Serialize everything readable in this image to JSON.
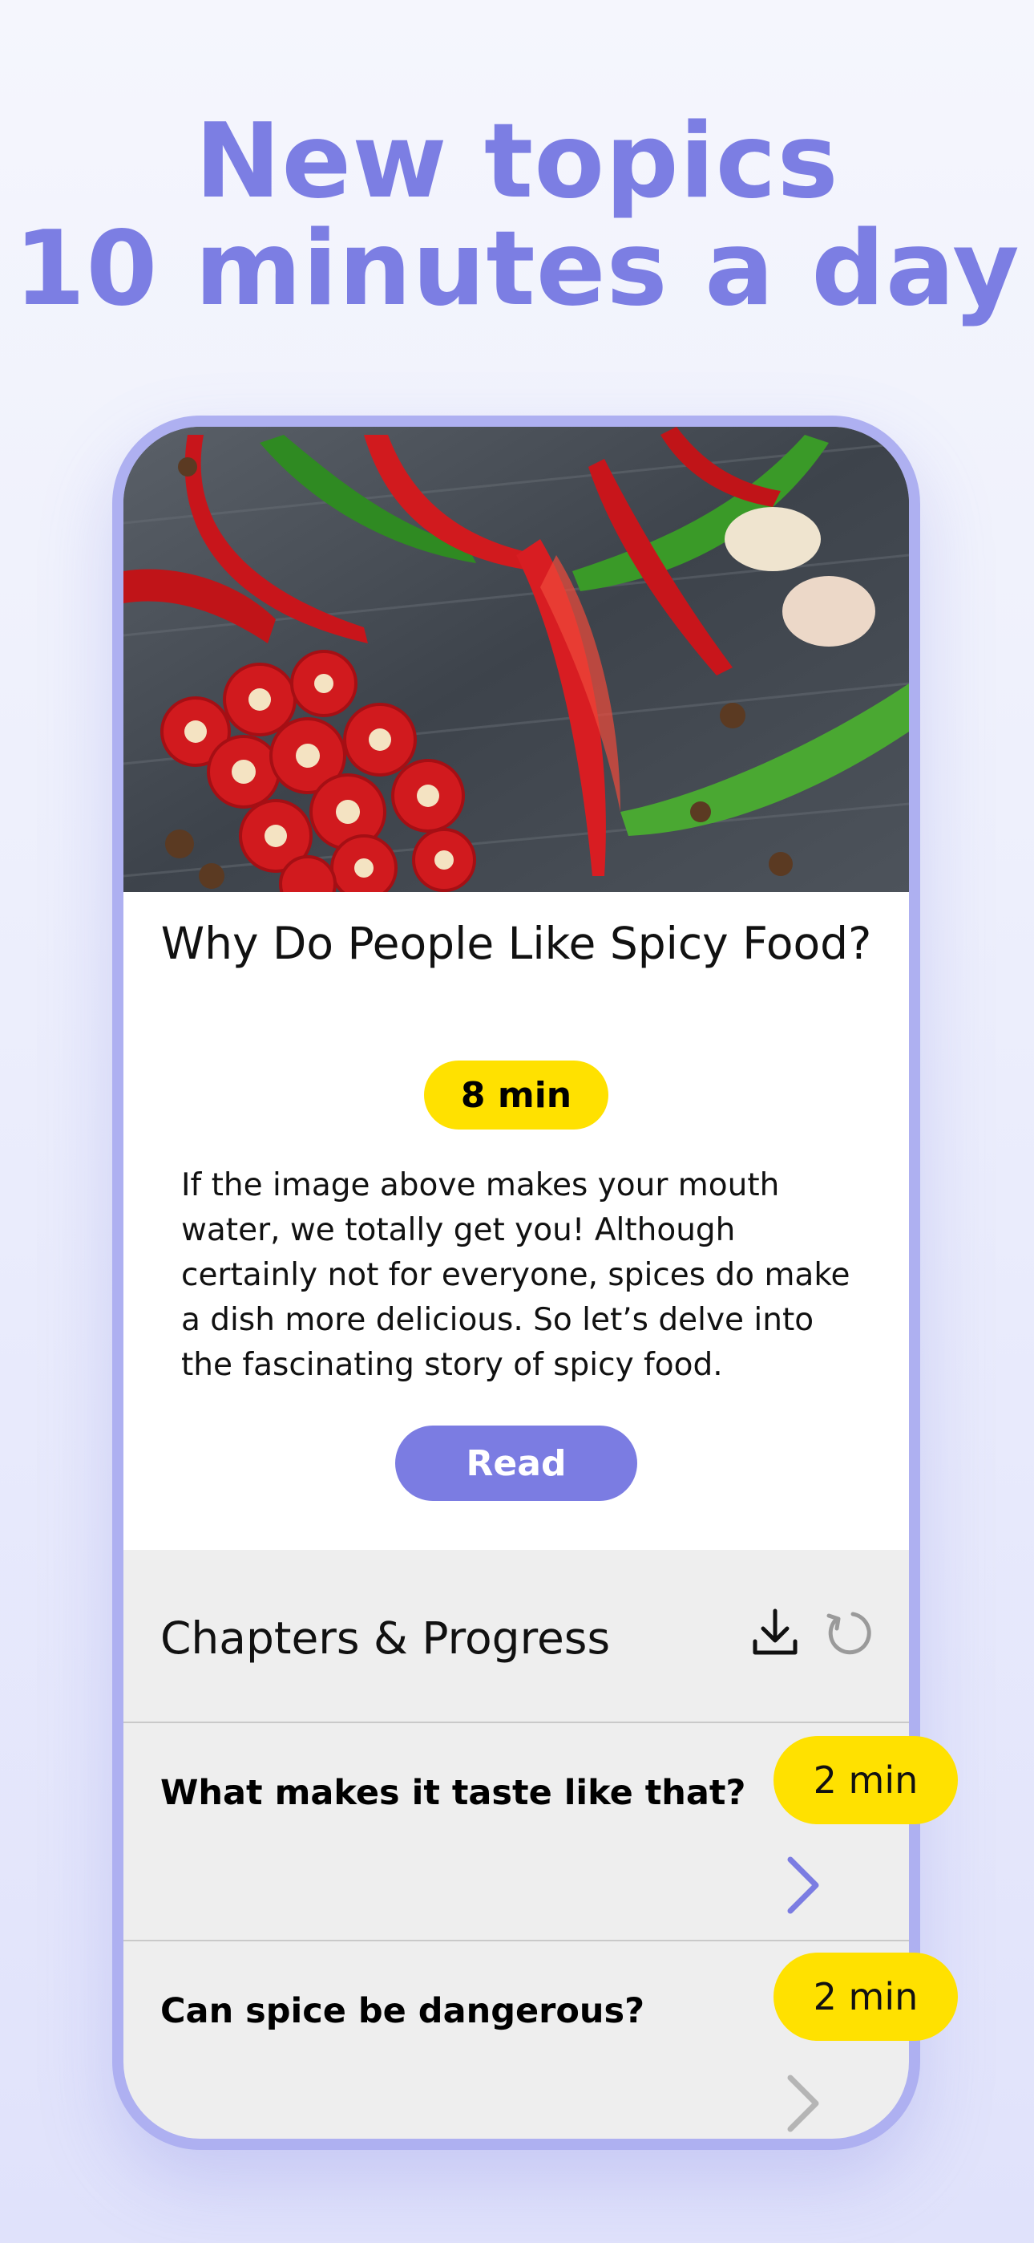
{
  "headline": {
    "line1": "New topics",
    "line2": "10 minutes a day"
  },
  "article": {
    "title": "Why Do People Like Spicy Food?",
    "duration": "8 min",
    "description": "If the image above makes your mouth water, we totally get you! Although certainly not for everyone, spices do make a dish more delicious. So let’s delve into the fascinating story of spicy food.",
    "read_label": "Read"
  },
  "chapters": {
    "title": "Chapters & Progress",
    "download_icon": "download-icon",
    "reset_icon": "reset-icon",
    "items": [
      {
        "title": "What makes it taste like that?",
        "duration": "2 min",
        "chevron_color": "#7b7ce2"
      },
      {
        "title": "Can spice be dangerous?",
        "duration": "2 min",
        "chevron_color": "#b5b5b5"
      }
    ]
  },
  "colors": {
    "accent": "#7b7ce2",
    "badge": "#ffe100",
    "frame": "#aeb0f1"
  }
}
